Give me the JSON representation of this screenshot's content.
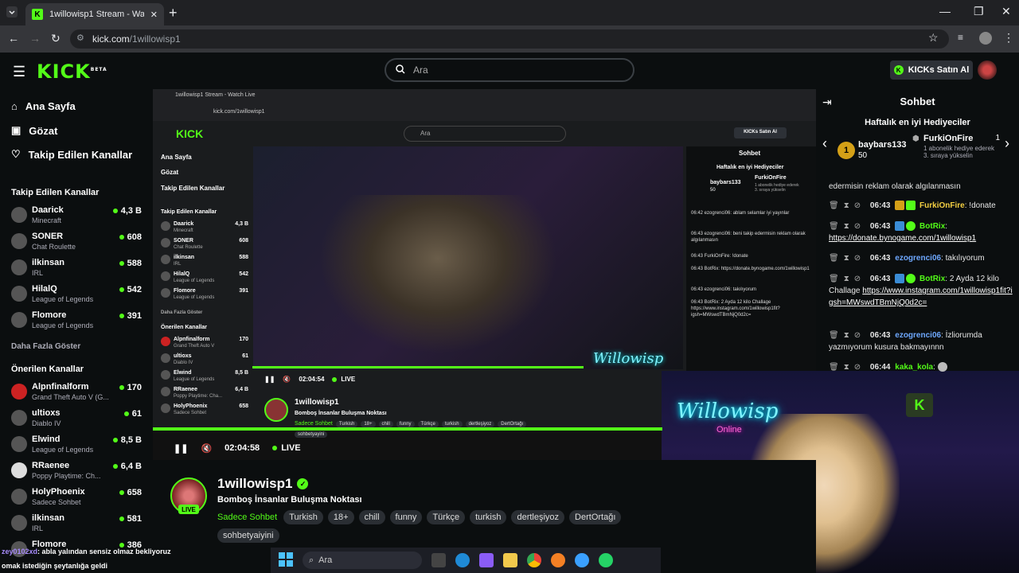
{
  "browser": {
    "tab_title": "1willowisp1 Stream - Watch Live",
    "new_tab": "+",
    "url_domain": "kick.com",
    "url_path": "/1willowisp1"
  },
  "header": {
    "logo": "KICK",
    "logo_sup": "BETA",
    "search_placeholder": "Ara",
    "kicks_button": "KICKs Satın Al"
  },
  "sidebar": {
    "nav": [
      {
        "label": "Ana Sayfa",
        "icon": "home-icon"
      },
      {
        "label": "Gözat",
        "icon": "browse-icon"
      },
      {
        "label": "Takip Edilen Kanallar",
        "icon": "heart-icon"
      }
    ],
    "followed_title": "Takip Edilen Kanallar",
    "followed": [
      {
        "name": "Daarick",
        "game": "Minecraft",
        "count": "4,3 B"
      },
      {
        "name": "SONER",
        "game": "Chat Roulette",
        "count": "608"
      },
      {
        "name": "ilkinsan",
        "game": "IRL",
        "count": "588"
      },
      {
        "name": "HilalQ",
        "game": "League of Legends",
        "count": "542"
      },
      {
        "name": "Flomore",
        "game": "League of Legends",
        "count": "391"
      }
    ],
    "show_more": "Daha Fazla Göster",
    "recommended_title": "Önerilen Kanallar",
    "recommended": [
      {
        "name": "Alpnfinalform",
        "game": "Grand Theft Auto V (G...",
        "count": "170"
      },
      {
        "name": "ultioxs",
        "game": "Diablo IV",
        "count": "61"
      },
      {
        "name": "Elwind",
        "game": "League of Legends",
        "count": "8,5 B"
      },
      {
        "name": "RRaenee",
        "game": "Poppy Playtime: Ch...",
        "count": "6,4 B"
      },
      {
        "name": "HolyPhoenix",
        "game": "Sadece Sohbet",
        "count": "658"
      },
      {
        "name": "ilkinsan",
        "game": "IRL",
        "count": "581"
      },
      {
        "name": "Flomore",
        "game": "",
        "count": "386"
      }
    ]
  },
  "player": {
    "time": "02:04:58",
    "live": "LIVE",
    "nested_time": "02:04:54",
    "neon_text": "Willowisp",
    "neon_sub": "Online"
  },
  "stream": {
    "channel": "1willowisp1",
    "live_badge": "LIVE",
    "title": "Bomboş İnsanlar Buluşma Noktası",
    "category": "Sadece Sohbet",
    "tags": [
      "Turkish",
      "18+",
      "chill",
      "funny",
      "Türkçe",
      "turkish",
      "dertleşiyoz",
      "DertOrtağı"
    ],
    "tag_extra": "sohbetyaiyini"
  },
  "taskbar": {
    "search": "Ara"
  },
  "overlay_chat": [
    {
      "user": "zey0102xd",
      "text": ": abla yalından sensiz olmaz bekliyoruz"
    },
    {
      "user": "",
      "text": "omak istediğin şeytanlığa geldi"
    }
  ],
  "chat": {
    "title": "Sohbet",
    "gifts_title": "Haftalık en iyi Hediyeciler",
    "gift1": {
      "rank": "1",
      "user": "baybars133",
      "value": "50"
    },
    "gift2": {
      "user": "FurkiOnFire",
      "value": "1",
      "desc": "1 abonelik hediye ederek 3. sıraya yükselin"
    },
    "messages": [
      {
        "time": "",
        "user": "",
        "user_class": "",
        "text": "edermisin reklam olarak algılanmasın",
        "link": ""
      },
      {
        "time": "06:43",
        "user": "FurkiOnFire",
        "user_class": "u-fu",
        "text": "!donate",
        "link": ""
      },
      {
        "time": "06:43",
        "user": "BotRix",
        "user_class": "u-bot",
        "text": "",
        "link": "https://donate.bynogame.com/1willowisp1"
      },
      {
        "time": "06:43",
        "user": "ezogrenci06",
        "user_class": "u-ez",
        "text": "takılıyorum",
        "link": ""
      },
      {
        "time": "06:43",
        "user": "BotRix",
        "user_class": "u-bot",
        "text": "2 Ayda 12 kilo Challage",
        "link": "https://www.instagram.com/1willowisp1fit?igsh=MWswdTBmNjQ0d2c="
      },
      {
        "time": "06:43",
        "user": "ezogrenci06",
        "user_class": "u-ez",
        "text": "İzliorumda yazmıyorum kusura bakmayınnn",
        "link": ""
      },
      {
        "time": "06:44",
        "user": "kaka_kola",
        "user_class": "u-ka",
        "text": "",
        "link": ""
      }
    ]
  },
  "mini": {
    "title": "1willowisp1 Stream - Watch Live",
    "url": "kick.com/1willowisp1",
    "search": "Ara",
    "kicks": "KICKs Satın Al",
    "nav": [
      "Ana Sayfa",
      "Gözat",
      "Takip Edilen Kanallar"
    ],
    "chat_title": "Sohbet",
    "gifts_title": "Haftalık en iyi Hediyeciler",
    "gift_user": "baybars133",
    "gift_value": "50",
    "gift2_user": "FurkiOnFire",
    "gift2_desc": "1 abonelik hediye ederek 3. sıraya yükselin",
    "messages": [
      "06:42 ezogrenci06: ablam selamlar iyi yayınlar",
      "06:43 ezogrenci06: beni takip edermisin reklam olarak algılanmasın",
      "06:43 FurkiOnFire: !donate",
      "06:43 BotRix: https://donate.bynogame.com/1willowisp1",
      "06:43 ezogrenci06: takılıyorum",
      "06:43 BotRix: 2 Ayda 12 kilo Challage https://www.instagram.com/1willowisp1fit?igsh=MWswdTBmNjQ0d2c="
    ],
    "followed_title": "Takip Edilen Kanallar",
    "followed": [
      {
        "name": "Daarick",
        "game": "Minecraft",
        "count": "4,3 B"
      },
      {
        "name": "SONER",
        "game": "Chat Roulette",
        "count": "608"
      },
      {
        "name": "ilkinsan",
        "game": "IRL",
        "count": "588"
      },
      {
        "name": "HilalQ",
        "game": "League of Legends",
        "count": "542"
      },
      {
        "name": "Flomore",
        "game": "League of Legends",
        "count": "391"
      }
    ],
    "show_more": "Daha Fazla Göster",
    "recommended_title": "Önerilen Kanallar",
    "recommended": [
      {
        "name": "Alpnfinalform",
        "game": "Grand Theft Auto V",
        "count": "170"
      },
      {
        "name": "ultioxs",
        "game": "Diablo IV",
        "count": "61"
      },
      {
        "name": "Elwind",
        "game": "League of Legends",
        "count": "8,5 B"
      },
      {
        "name": "RRaenee",
        "game": "Poppy Playtime: Cha...",
        "count": "6,4 B"
      },
      {
        "name": "HolyPhoenix",
        "game": "Sadece Sohbet",
        "count": "658"
      }
    ],
    "channel": "1willowisp1",
    "stream_title": "Bomboş İnsanlar Buluşma Noktası",
    "category": "Sadece Sohbet",
    "tags": [
      "Turkish",
      "18+",
      "chill",
      "funny",
      "Türkçe",
      "turkish",
      "dertleşiyoz",
      "DertOrtağı"
    ],
    "tag_extra": "sohbetyayini"
  },
  "colors": {
    "accent": "#53fc18",
    "bg": "#0b0e0f"
  }
}
